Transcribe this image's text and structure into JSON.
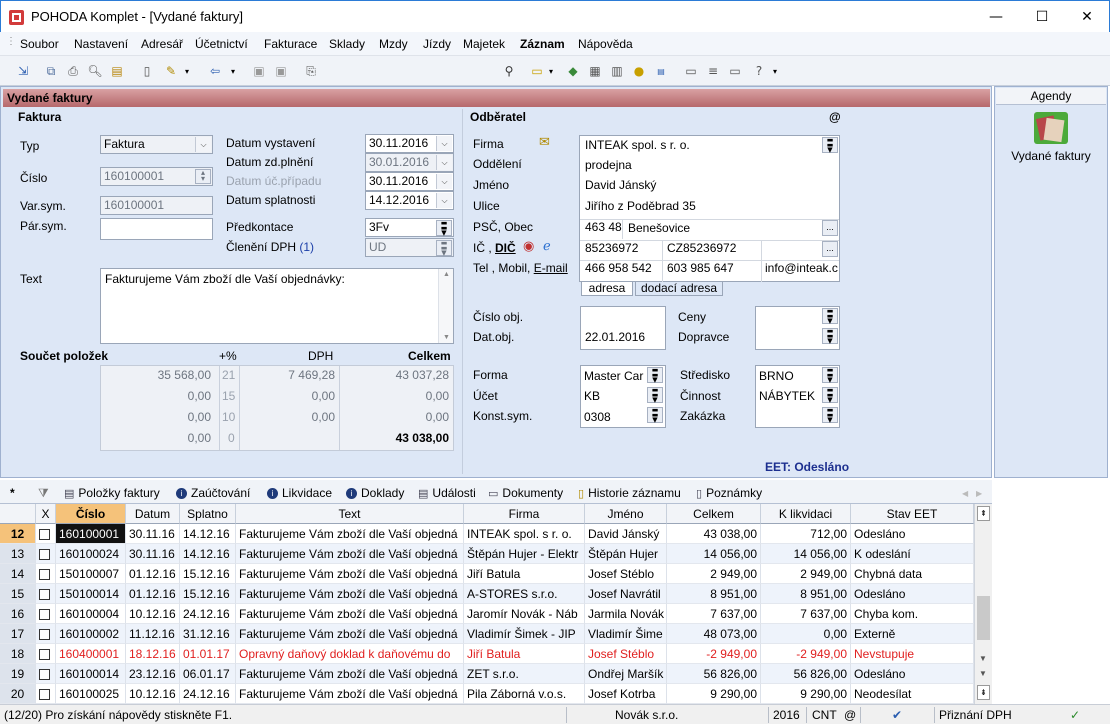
{
  "window": {
    "title": "POHODA Komplet - [Vydané faktury]",
    "min": "—",
    "max": "☐",
    "close": "✕"
  },
  "menu": [
    "Soubor",
    "Nastavení",
    "Adresář",
    "Účetnictví",
    "Fakturace",
    "Sklady",
    "Mzdy",
    "Jízdy",
    "Majetek",
    "Záznam",
    "Nápověda"
  ],
  "agenda_title": "Vydané faktury",
  "faktura": {
    "section": "Faktura",
    "typ_label": "Typ",
    "typ": "Faktura",
    "cislo_label": "Číslo",
    "cislo": "160100001",
    "varsym_label": "Var.sym.",
    "varsym": "160100001",
    "parsym_label": "Pár.sym.",
    "parsym": "",
    "datum_vystaveni_label": "Datum vystavení",
    "datum_vystaveni": "30.11.2016",
    "datum_zd_label": "Datum zd.plnění",
    "datum_zd": "30.01.2016",
    "datum_uc_label": "Datum úč.případu",
    "datum_uc": "30.11.2016",
    "datum_splat_label": "Datum splatnosti",
    "datum_splat": "14.12.2016",
    "predkontace_label": "Předkontace",
    "predkontace": "3Fv",
    "cleneni_label": "Členění DPH",
    "cleneni_count": "(1)",
    "cleneni": "UD",
    "text_label": "Text",
    "text": "Fakturujeme Vám zboží dle Vaší objednávky:"
  },
  "soucet": {
    "label": "Součet položek",
    "h_pct": "+%",
    "h_dph": "DPH",
    "h_celkem": "Celkem",
    "rows": [
      {
        "base": "35 568,00",
        "pct": "21",
        "dph": "7 469,28",
        "celkem": "43 037,28"
      },
      {
        "base": "0,00",
        "pct": "15",
        "dph": "0,00",
        "celkem": "0,00"
      },
      {
        "base": "0,00",
        "pct": "10",
        "dph": "0,00",
        "celkem": "0,00"
      },
      {
        "base": "0,00",
        "pct": "0",
        "dph": "",
        "celkem": "43 038,00"
      }
    ]
  },
  "odberatel": {
    "section": "Odběratel",
    "at": "@",
    "firma_label": "Firma",
    "firma": "INTEAK spol. s r. o.",
    "oddeleni_label": "Oddělení",
    "oddeleni": "prodejna",
    "jmeno_label": "Jméno",
    "jmeno": "David Jánský",
    "ulice_label": "Ulice",
    "ulice": "Jiřího z Poděbrad 35",
    "psc_label": "PSČ, Obec",
    "psc": "463 48",
    "obec": "Benešovice",
    "ic_label": "IČ , ",
    "dic_label": "DIČ",
    "ic": "85236972",
    "dic": "CZ85236972",
    "tel_label": "Tel , Mobil, ",
    "email_label": "E-mail",
    "tel": "466 958 542",
    "mobil": "603 985 647",
    "email": "info@inteak.c",
    "tab_adresa": "adresa",
    "tab_dodaci": "dodací adresa",
    "cislo_obj_label": "Číslo obj.",
    "cislo_obj": "",
    "dat_obj_label": "Dat.obj.",
    "dat_obj": "22.01.2016",
    "ceny_label": "Ceny",
    "ceny": "",
    "dopravce_label": "Dopravce",
    "dopravce": "",
    "forma_label": "Forma",
    "forma": "Master Car",
    "ucet_label": "Účet",
    "ucet": "KB",
    "konst_label": "Konst.sym.",
    "konst": "0308",
    "stredisko_label": "Středisko",
    "stredisko": "BRNO",
    "cinnost_label": "Činnost",
    "cinnost": "NÁBYTEK",
    "zakazka_label": "Zakázka",
    "zakazka": "",
    "eet": "EET: Odesláno"
  },
  "right": {
    "header": "Agendy",
    "item": "Vydané faktury"
  },
  "tabs": [
    "Položky faktury",
    "Zaúčtování",
    "Likvidace",
    "Doklady",
    "Události",
    "Dokumenty",
    "Historie záznamu",
    "Poznámky"
  ],
  "grid": {
    "columns": [
      "X",
      "Číslo",
      "Datum",
      "Splatno",
      "Text",
      "Firma",
      "Jméno",
      "Celkem",
      "K likvidaci",
      "Stav EET"
    ],
    "rows": [
      {
        "n": "12",
        "cislo": "160100001",
        "datum": "30.11.16",
        "splatno": "14.12.16",
        "text": "Fakturujeme Vám zboží dle Vaší objedná",
        "firma": "INTEAK spol. s r. o.",
        "jmeno": "David Jánský",
        "celkem": "43 038,00",
        "klik": "712,00",
        "stav": "Odesláno"
      },
      {
        "n": "13",
        "cislo": "160100024",
        "datum": "30.11.16",
        "splatno": "14.12.16",
        "text": "Fakturujeme Vám zboží dle Vaší objedná",
        "firma": "Štěpán Hujer - Elektr",
        "jmeno": "Štěpán Hujer",
        "celkem": "14 056,00",
        "klik": "14 056,00",
        "stav": "K odeslání"
      },
      {
        "n": "14",
        "cislo": "150100007",
        "datum": "01.12.16",
        "splatno": "15.12.16",
        "text": "Fakturujeme Vám zboží dle Vaší objedná",
        "firma": "Jiří Batula",
        "jmeno": "Josef Stéblo",
        "celkem": "2 949,00",
        "klik": "2 949,00",
        "stav": "Chybná data"
      },
      {
        "n": "15",
        "cislo": "150100014",
        "datum": "01.12.16",
        "splatno": "15.12.16",
        "text": "Fakturujeme Vám zboží dle Vaší objedná",
        "firma": "A-STORES s.r.o.",
        "jmeno": "Josef Navrátil",
        "celkem": "8 951,00",
        "klik": "8 951,00",
        "stav": "Odesláno"
      },
      {
        "n": "16",
        "cislo": "160100004",
        "datum": "10.12.16",
        "splatno": "24.12.16",
        "text": "Fakturujeme Vám zboží dle Vaší objedná",
        "firma": "Jaromír Novák - Náb",
        "jmeno": "Jarmila Novák",
        "celkem": "7 637,00",
        "klik": "7 637,00",
        "stav": "Chyba kom."
      },
      {
        "n": "17",
        "cislo": "160100002",
        "datum": "11.12.16",
        "splatno": "31.12.16",
        "text": "Fakturujeme Vám zboží dle Vaší objedná",
        "firma": "Vladimír Šimek - JIP",
        "jmeno": "Vladimír Šime",
        "celkem": "48 073,00",
        "klik": "0,00",
        "stav": "Externě"
      },
      {
        "n": "18",
        "cislo": "160400001",
        "datum": "18.12.16",
        "splatno": "01.01.17",
        "text": "Opravný daňový doklad k daňovému do",
        "firma": "Jiří Batula",
        "jmeno": "Josef Stéblo",
        "celkem": "-2 949,00",
        "klik": "-2 949,00",
        "stav": "Nevstupuje",
        "red": true
      },
      {
        "n": "19",
        "cislo": "160100014",
        "datum": "23.12.16",
        "splatno": "06.01.17",
        "text": "Fakturujeme Vám zboží dle Vaší objedná",
        "firma": "ZET s.r.o.",
        "jmeno": "Ondřej Maršík",
        "celkem": "56 826,00",
        "klik": "56 826,00",
        "stav": "Odesláno"
      },
      {
        "n": "20",
        "cislo": "160100025",
        "datum": "10.12.16",
        "splatno": "24.12.16",
        "text": "Fakturujeme Vám zboží dle Vaší objedná",
        "firma": "Pila Záborná v.o.s.",
        "jmeno": "Josef Kotrba",
        "celkem": "9 290,00",
        "klik": "9 290,00",
        "stav": "Neodesílat"
      }
    ]
  },
  "status": {
    "hint": "(12/20) Pro získání nápovědy stiskněte F1.",
    "company": "Novák s.r.o.",
    "year": "2016",
    "cnt": "CNT",
    "at": "@",
    "dph": "Přiznání DPH"
  }
}
